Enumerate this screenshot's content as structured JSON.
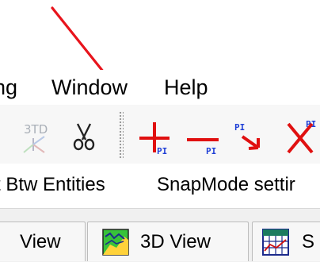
{
  "menu": {
    "items": [
      "ng",
      "Window",
      "Help"
    ]
  },
  "toolbar": {
    "buttons": [
      {
        "icon": "3d-axes-icon",
        "label": "3TD",
        "state": "disabled"
      },
      {
        "icon": "scissors-icon"
      },
      {
        "icon": "add-pi-icon",
        "label": "PI"
      },
      {
        "icon": "delete-pi-icon",
        "label": "PI"
      },
      {
        "icon": "move-pi-icon",
        "label": "PI"
      },
      {
        "icon": "remove-pi-icon",
        "label": "PI"
      }
    ]
  },
  "snapbar": {
    "items": [
      "t Btw Entities",
      "SnapMode settir"
    ]
  },
  "tabs": [
    {
      "label": "View",
      "icon": null
    },
    {
      "label": "3D View",
      "icon": "terrain-3d-icon"
    },
    {
      "label": "S",
      "icon": "profile-grid-icon"
    }
  ],
  "colors": {
    "callout_arrow": "#e8141c",
    "pi_red": "#e01010",
    "pi_blue": "#1f3fd6",
    "toolbar_bg": "#f7f7f7"
  }
}
